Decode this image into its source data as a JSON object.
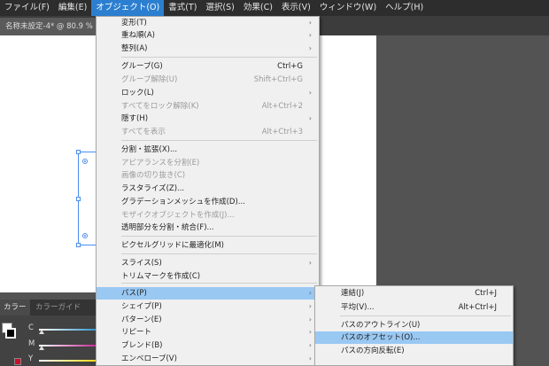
{
  "menubar": {
    "items": [
      "ファイル(F)",
      "編集(E)",
      "オブジェクト(O)",
      "書式(T)",
      "選択(S)",
      "効果(C)",
      "表示(V)",
      "ウィンドウ(W)",
      "ヘルプ(H)"
    ]
  },
  "document": {
    "tab_label": "名称未設定-4* @ 80.9 % ("
  },
  "color_panel": {
    "tabs": [
      "カラー",
      "カラーガイド"
    ],
    "channels": [
      "C",
      "M",
      "Y"
    ]
  },
  "object_menu": {
    "items": [
      {
        "label": "変形(T)",
        "shortcut": "",
        "submenu": true,
        "disabled": false
      },
      {
        "label": "重ね順(A)",
        "shortcut": "",
        "submenu": true,
        "disabled": false
      },
      {
        "label": "整列(A)",
        "shortcut": "",
        "submenu": true,
        "disabled": false
      },
      {
        "label": "グループ(G)",
        "shortcut": "Ctrl+G",
        "submenu": false,
        "disabled": false
      },
      {
        "label": "グループ解除(U)",
        "shortcut": "Shift+Ctrl+G",
        "submenu": false,
        "disabled": true
      },
      {
        "label": "ロック(L)",
        "shortcut": "",
        "submenu": true,
        "disabled": false
      },
      {
        "label": "すべてをロック解除(K)",
        "shortcut": "Alt+Ctrl+2",
        "submenu": false,
        "disabled": true
      },
      {
        "label": "隠す(H)",
        "shortcut": "",
        "submenu": true,
        "disabled": false
      },
      {
        "label": "すべてを表示",
        "shortcut": "Alt+Ctrl+3",
        "submenu": false,
        "disabled": true
      },
      {
        "label": "分割・拡張(X)...",
        "shortcut": "",
        "submenu": false,
        "disabled": false
      },
      {
        "label": "アピアランスを分割(E)",
        "shortcut": "",
        "submenu": false,
        "disabled": true
      },
      {
        "label": "画像の切り抜き(C)",
        "shortcut": "",
        "submenu": false,
        "disabled": true
      },
      {
        "label": "ラスタライズ(Z)...",
        "shortcut": "",
        "submenu": false,
        "disabled": false
      },
      {
        "label": "グラデーションメッシュを作成(D)...",
        "shortcut": "",
        "submenu": false,
        "disabled": false
      },
      {
        "label": "モザイクオブジェクトを作成(J)...",
        "shortcut": "",
        "submenu": false,
        "disabled": true
      },
      {
        "label": "透明部分を分割・統合(F)...",
        "shortcut": "",
        "submenu": false,
        "disabled": false
      },
      {
        "label": "ピクセルグリッドに最適化(M)",
        "shortcut": "",
        "submenu": false,
        "disabled": false
      },
      {
        "label": "スライス(S)",
        "shortcut": "",
        "submenu": true,
        "disabled": false
      },
      {
        "label": "トリムマークを作成(C)",
        "shortcut": "",
        "submenu": false,
        "disabled": false
      },
      {
        "label": "パス(P)",
        "shortcut": "",
        "submenu": true,
        "disabled": false,
        "highlighted": true
      },
      {
        "label": "シェイプ(P)",
        "shortcut": "",
        "submenu": true,
        "disabled": false
      },
      {
        "label": "パターン(E)",
        "shortcut": "",
        "submenu": true,
        "disabled": false
      },
      {
        "label": "リピート",
        "shortcut": "",
        "submenu": true,
        "disabled": false
      },
      {
        "label": "ブレンド(B)",
        "shortcut": "",
        "submenu": true,
        "disabled": false
      },
      {
        "label": "エンベロープ(V)",
        "shortcut": "",
        "submenu": true,
        "disabled": false
      }
    ]
  },
  "path_submenu": {
    "items": [
      {
        "label": "連結(J)",
        "shortcut": "Ctrl+J",
        "disabled": false
      },
      {
        "label": "平均(V)...",
        "shortcut": "Alt+Ctrl+J",
        "disabled": false
      },
      {
        "label": "パスのアウトライン(U)",
        "shortcut": "",
        "disabled": false
      },
      {
        "label": "パスのオフセット(O)...",
        "shortcut": "",
        "disabled": false,
        "highlighted": true
      },
      {
        "label": "パスの方向反転(E)",
        "shortcut": "",
        "disabled": false
      }
    ]
  },
  "colors": {
    "menubar_bg": "#2d2d2d",
    "active_menu": "#2c7fd0",
    "menu_highlight": "#99c8f3",
    "selection": "#4a8df0"
  }
}
